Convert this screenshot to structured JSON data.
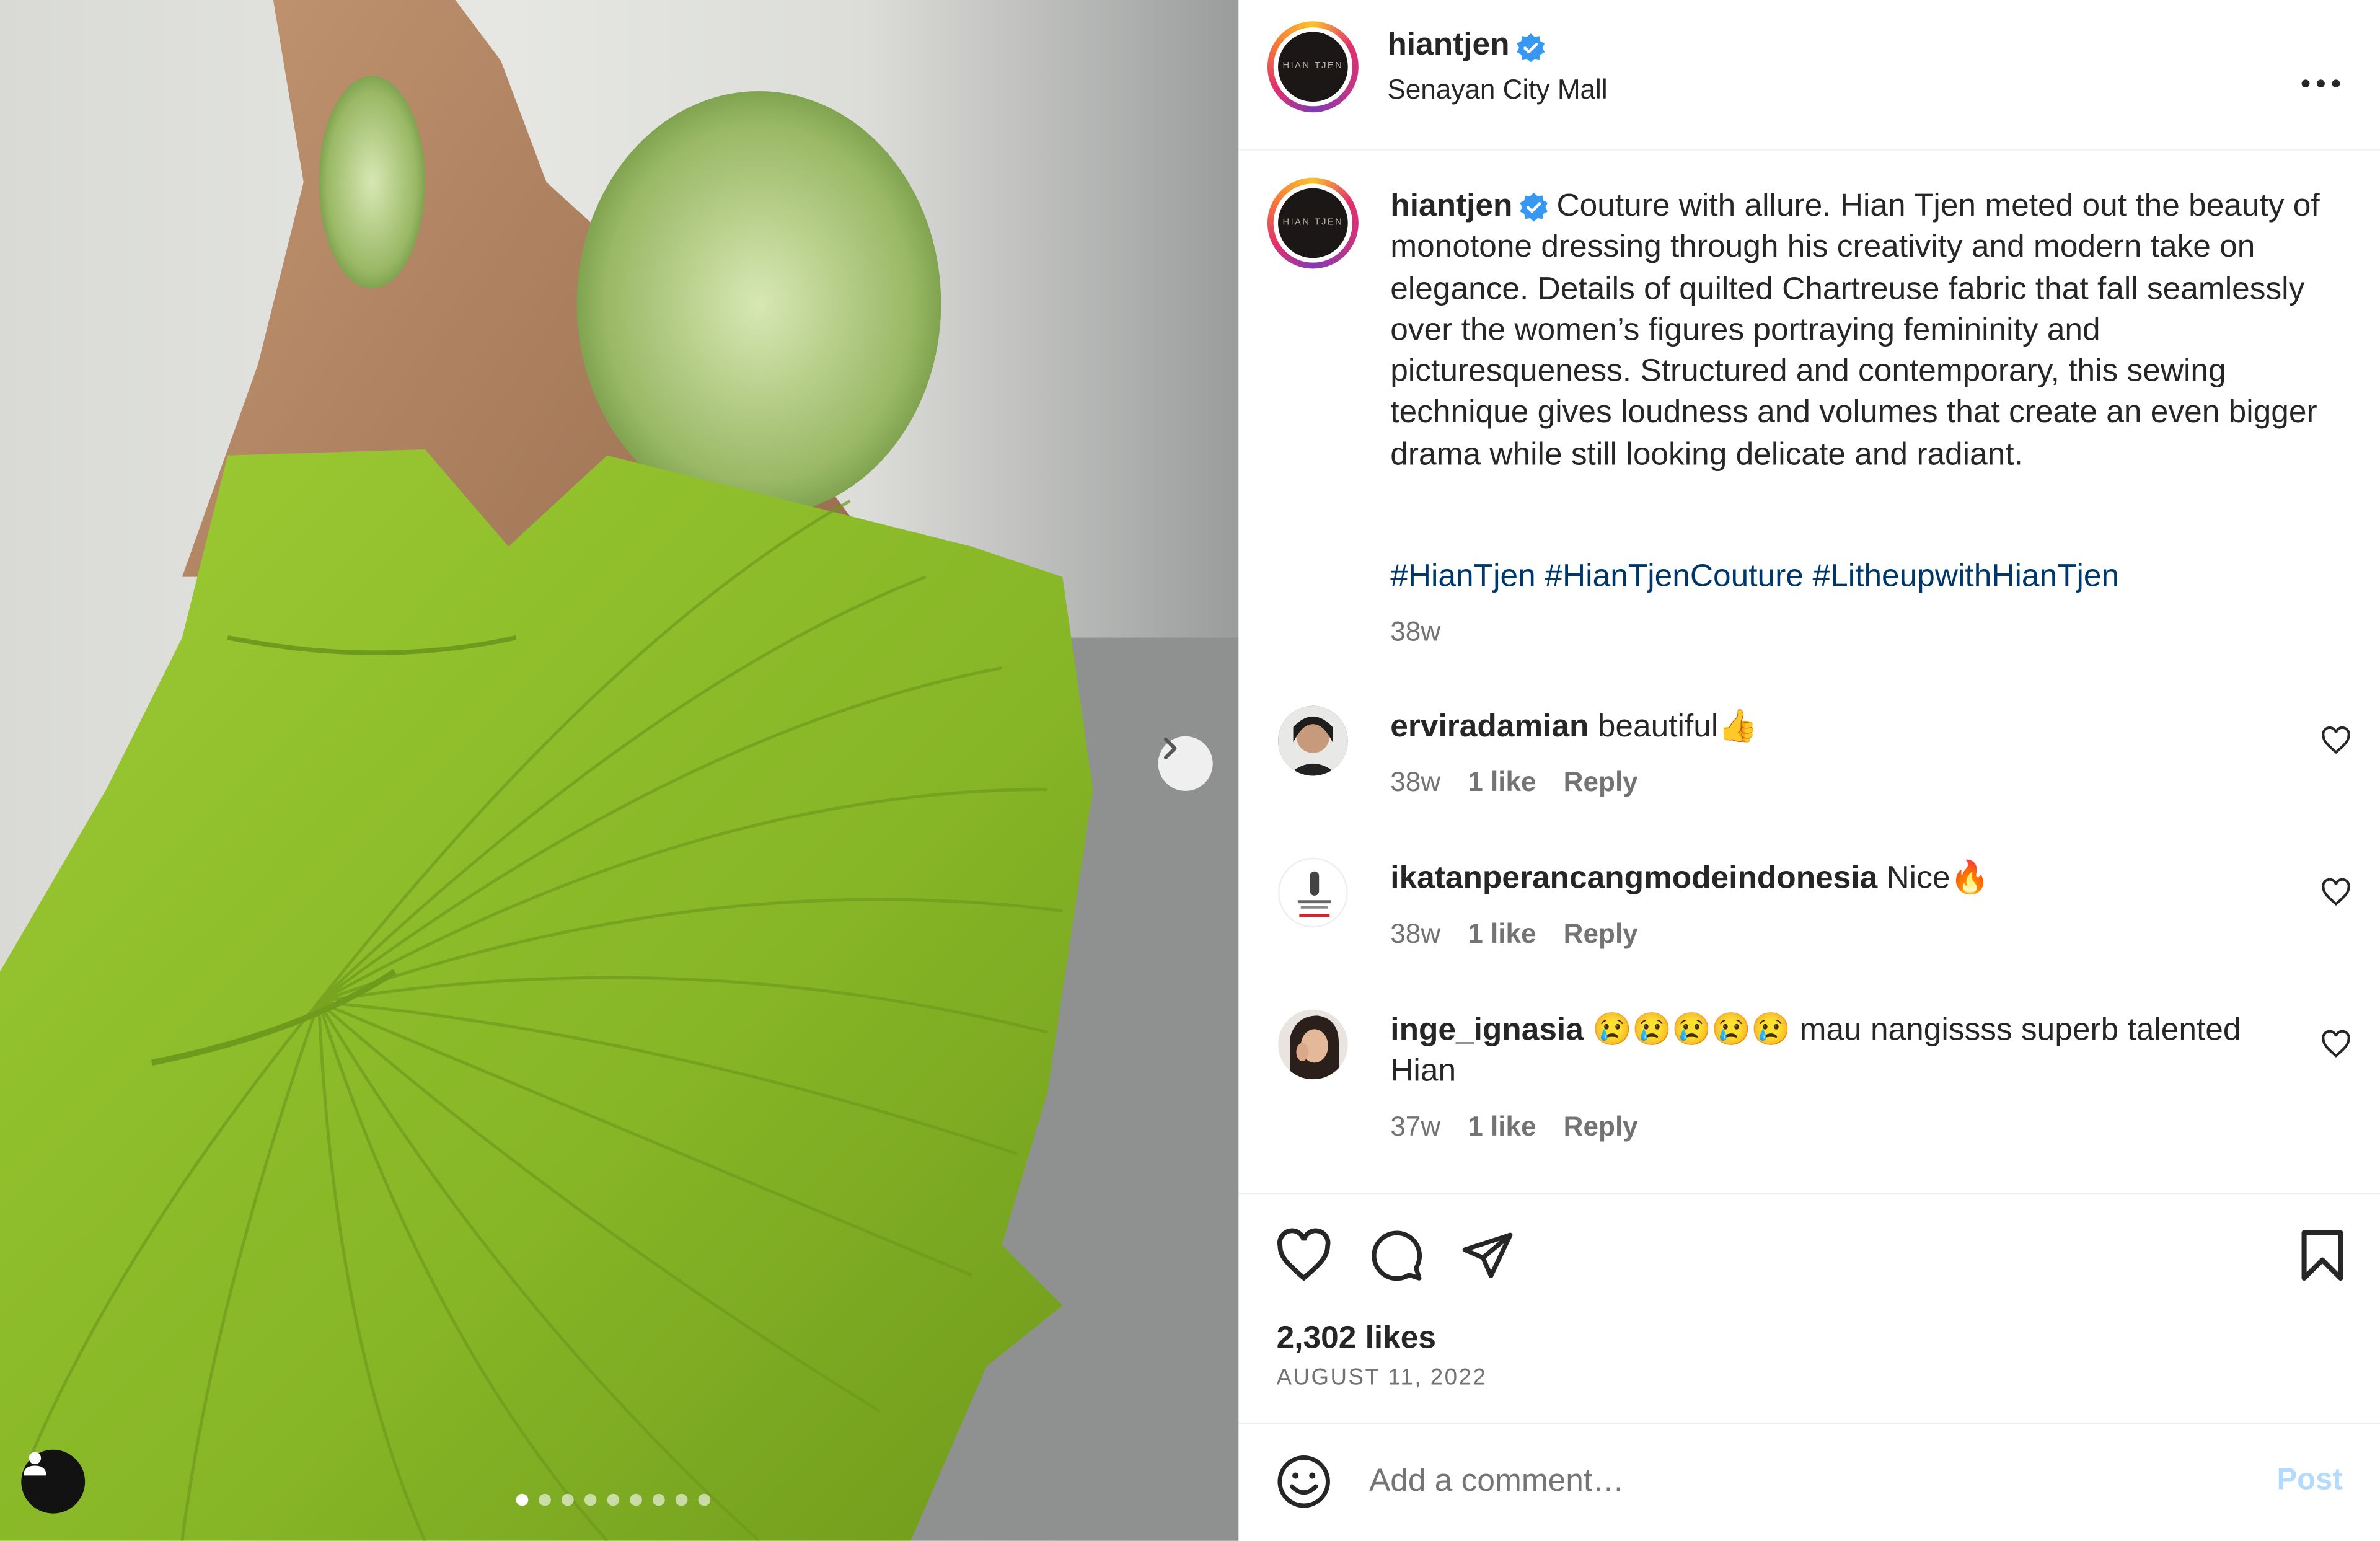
{
  "post": {
    "username": "hiantjen",
    "location": "Senayan City Mall",
    "logo_text": "HIAN TJEN",
    "more_icon": "more-horizontal-icon",
    "caption": "Couture with allure. Hian Tjen meted out the beauty of monotone dressing through his creativity and modern take on elegance. Details of quilted Chartreuse fabric that fall seamlessly over the women’s figures portraying femininity and picturesqueness. Structured and contemporary, this sewing technique gives loudness and volumes that create an even bigger drama while still looking delicate and radiant.",
    "hashtags": [
      "#HianTjen",
      "#HianTjenCouture",
      "#LitheupwithHianTjen"
    ],
    "caption_time": "38w",
    "likes": "2,302 likes",
    "date": "AUGUST 11, 2022"
  },
  "media": {
    "slide_count": 9,
    "active_slide": 1
  },
  "comments": [
    {
      "username": "erviradamian",
      "text": "beautiful👍",
      "time": "38w",
      "likes": "1 like",
      "reply": "Reply"
    },
    {
      "username": "ikatanperancangmodeindonesia",
      "text": "Nice🔥",
      "time": "38w",
      "likes": "1 like",
      "reply": "Reply"
    },
    {
      "username": "inge_ignasia",
      "text": "😢😢😢😢😢 mau nangissss superb talented Hian",
      "time": "37w",
      "likes": "1 like",
      "reply": "Reply"
    }
  ],
  "add_comment": {
    "placeholder": "Add a comment…",
    "post_label": "Post"
  },
  "colors": {
    "verified": "#3897f0",
    "hashtag": "#00376b",
    "post_button": "#b3dbff",
    "dress": "#8cbd2a"
  }
}
